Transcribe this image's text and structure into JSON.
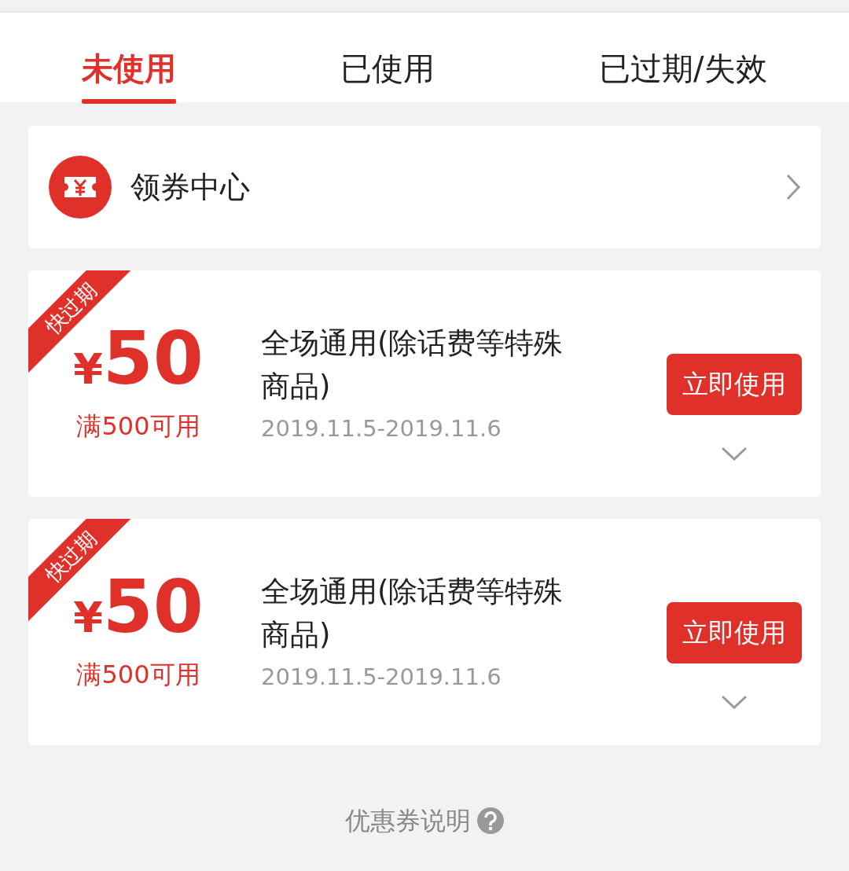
{
  "tabs": [
    {
      "label": "未使用",
      "selected": true
    },
    {
      "label": "已使用",
      "selected": false
    },
    {
      "label": "已过期/失效",
      "selected": false
    }
  ],
  "coupon_center": {
    "label": "领券中心"
  },
  "coupons": [
    {
      "tag": "快过期",
      "currency": "¥",
      "amount": "50",
      "condition": "满500可用",
      "title": "全场通用(除话费等特殊商品)",
      "validity": "2019.11.5-2019.11.6",
      "button": "立即使用",
      "expanded": false
    },
    {
      "tag": "快过期",
      "currency": "¥",
      "amount": "50",
      "condition": "满500可用",
      "title": "全场通用(除话费等特殊商品)",
      "validity": "2019.11.5-2019.11.6",
      "button": "立即使用",
      "expanded": false
    }
  ],
  "footer": {
    "label": "优惠券说明"
  }
}
